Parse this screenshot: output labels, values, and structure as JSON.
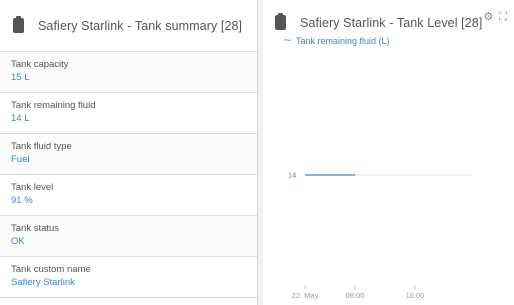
{
  "summary": {
    "title": "Safiery Starlink - Tank summary [28]",
    "rows": [
      {
        "label": "Tank capacity",
        "value": "15 L"
      },
      {
        "label": "Tank remaining fluid",
        "value": "14 L"
      },
      {
        "label": "Tank fluid type",
        "value": "Fuel"
      },
      {
        "label": "Tank level",
        "value": "91 %"
      },
      {
        "label": "Tank status",
        "value": "OK"
      },
      {
        "label": "Tank custom name",
        "value": "Safiery Starlink"
      }
    ]
  },
  "level": {
    "title": "Safiery Starlink - Tank Level [28]",
    "legend": "Tank remaining fluid (L)",
    "tools": {
      "settings_icon": "gear-icon",
      "expand_icon": "expand-icon"
    }
  },
  "colors": {
    "accent": "#3a86d4",
    "text": "#555555",
    "border": "#dcdcdc"
  },
  "chart_data": {
    "type": "line",
    "series": [
      {
        "name": "Tank remaining fluid (L)",
        "x": [
          "22. May",
          "08:00"
        ],
        "values": [
          14,
          14
        ]
      }
    ],
    "x_ticks": [
      "22. May",
      "08:00",
      "16:00"
    ],
    "y_labels": [
      "14"
    ],
    "ylim": [
      0,
      28
    ],
    "grid": true
  }
}
